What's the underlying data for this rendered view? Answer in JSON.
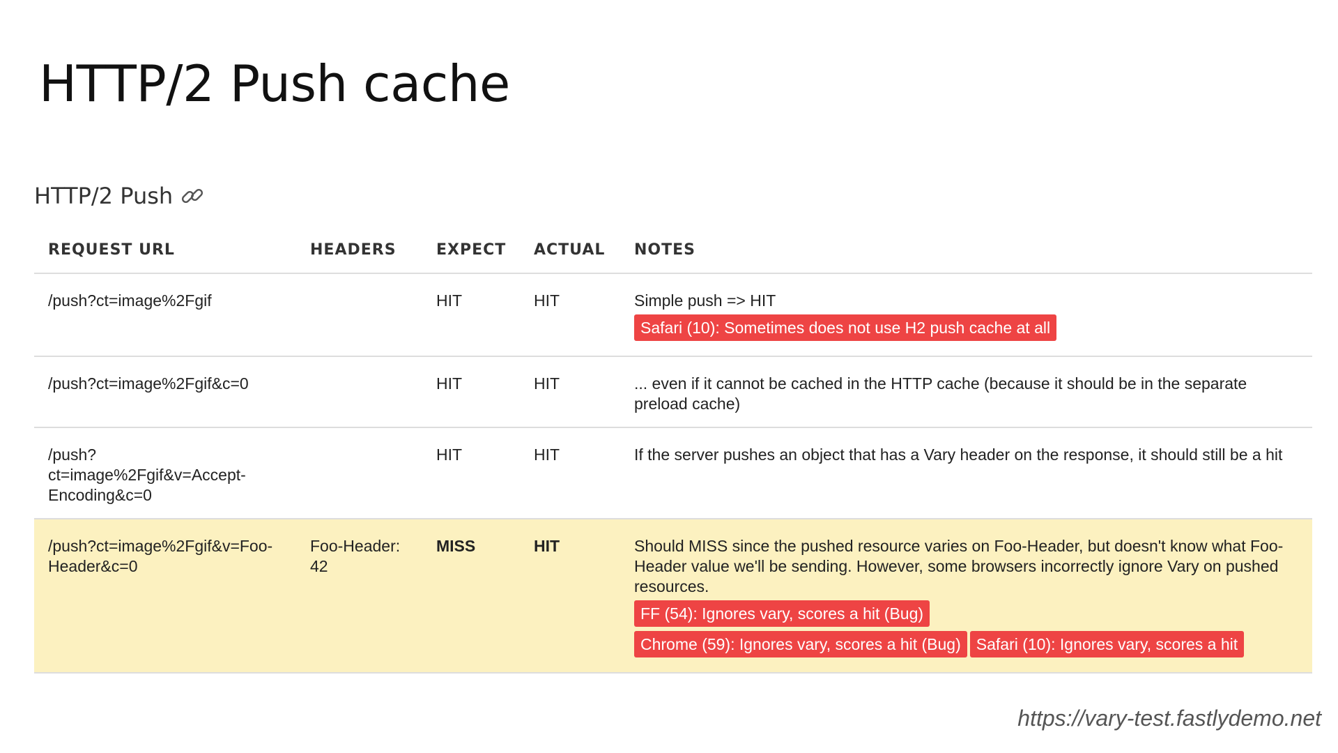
{
  "slide": {
    "title": "HTTP/2 Push cache",
    "section_heading": "HTTP/2 Push",
    "section_icon": "link-icon",
    "footer_url": "https://vary-test.fastlydemo.net"
  },
  "table": {
    "columns": [
      "REQUEST URL",
      "HEADERS",
      "EXPECT",
      "ACTUAL",
      "NOTES"
    ],
    "rows": [
      {
        "url": "/push?ct=image%2Fgif",
        "headers": "",
        "expect": "HIT",
        "actual": "HIT",
        "note": "Simple push => HIT",
        "badges": [
          "Safari (10): Sometimes does not use H2 push cache at all"
        ]
      },
      {
        "url": "/push?ct=image%2Fgif&c=0",
        "headers": "",
        "expect": "HIT",
        "actual": "HIT",
        "note": "... even if it cannot be cached in the HTTP cache (because it should be in the separate preload cache)",
        "badges": []
      },
      {
        "url": "/push?ct=image%2Fgif&v=Accept-Encoding&c=0",
        "headers": "",
        "expect": "HIT",
        "actual": "HIT",
        "note": "If the server pushes an object that has a Vary header on the response, it should still be a hit",
        "badges": []
      },
      {
        "url": "/push?ct=image%2Fgif&v=Foo-Header&c=0",
        "headers": "Foo-Header: 42",
        "expect": "MISS",
        "actual": "HIT",
        "note": "Should MISS since the pushed resource varies on Foo-Header, but doesn't know what Foo-Header value we'll be sending. However, some browsers incorrectly ignore Vary on pushed resources.",
        "badges": [
          "FF (54): Ignores vary, scores a hit (Bug)",
          "Chrome (59): Ignores vary, scores a hit (Bug)",
          "Safari (10): Ignores vary, scores a hit"
        ]
      }
    ]
  },
  "colors": {
    "badge_background": "#ee4444",
    "highlight_row": "#fcf1c0",
    "border": "#dddddd"
  }
}
